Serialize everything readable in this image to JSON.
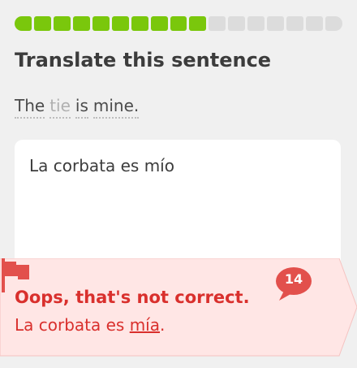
{
  "progress": {
    "completed": 10,
    "total": 17
  },
  "prompt": {
    "title": "Translate this sentence"
  },
  "sentence": {
    "words": [
      "The",
      "tie",
      "is",
      "mine."
    ]
  },
  "answer": {
    "value": "La corbata es mío"
  },
  "feedback": {
    "title": "Oops, that's not correct.",
    "correct_prefix": "La corbata es ",
    "correct_highlight": "mía",
    "correct_suffix": ".",
    "discussion_count": "14"
  },
  "colors": {
    "progress": "#7ac70c",
    "error": "#d9302d",
    "error_bg": "#ffe6e5"
  },
  "icons": {
    "discussion": "speech-bubble-icon",
    "report": "flag-icon"
  }
}
